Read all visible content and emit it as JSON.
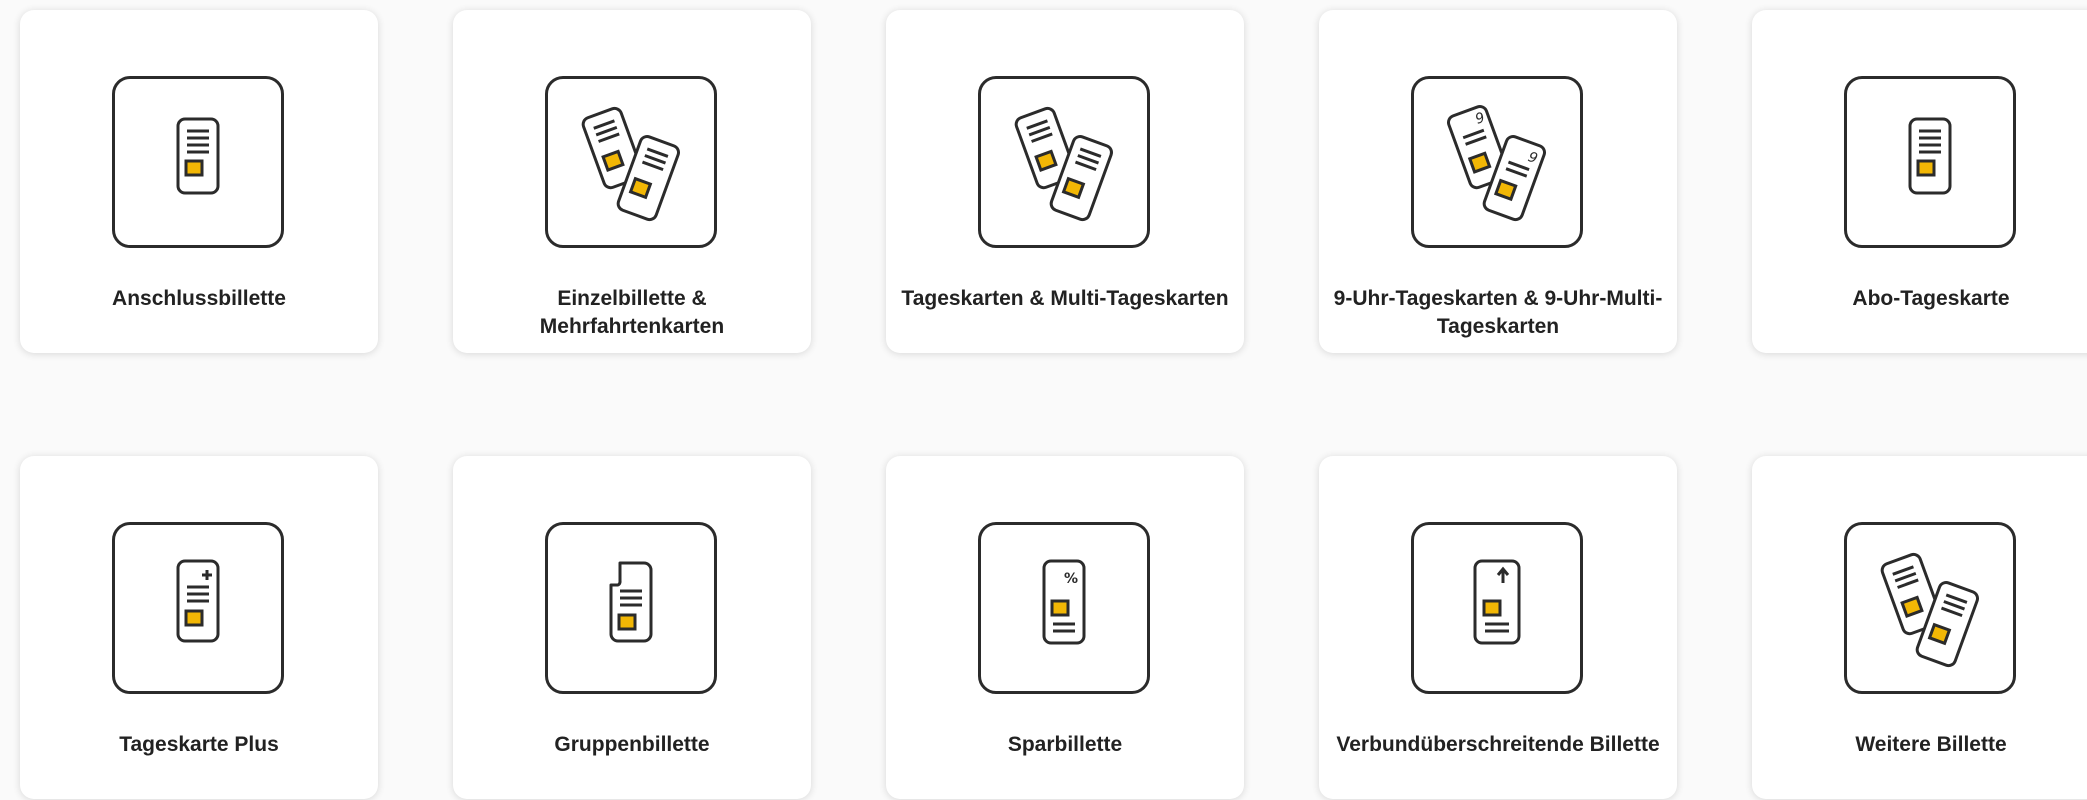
{
  "accent_color": "#f2b705",
  "cards": [
    {
      "label": "Anschlussbillette",
      "icon": "single-ticket-icon"
    },
    {
      "label": "Einzelbillette & Mehrfahrtenkarten",
      "icon": "two-tickets-icon"
    },
    {
      "label": "Tageskarten & Multi-Tageskarten",
      "icon": "two-tickets-icon"
    },
    {
      "label": "9-Uhr-Tageskarten & 9-Uhr-Multi-Tageskarten",
      "icon": "nine-oclock-tickets-icon"
    },
    {
      "label": "Abo-Tageskarte",
      "icon": "single-ticket-icon"
    },
    {
      "label": "Tageskarte Plus",
      "icon": "ticket-plus-icon"
    },
    {
      "label": "Gruppenbillette",
      "icon": "group-ticket-icon"
    },
    {
      "label": "Sparbillette",
      "icon": "discount-ticket-icon"
    },
    {
      "label": "Verbundüberschreitende Billette",
      "icon": "cross-network-ticket-icon"
    },
    {
      "label": "Weitere Billette",
      "icon": "two-tickets-icon"
    }
  ]
}
